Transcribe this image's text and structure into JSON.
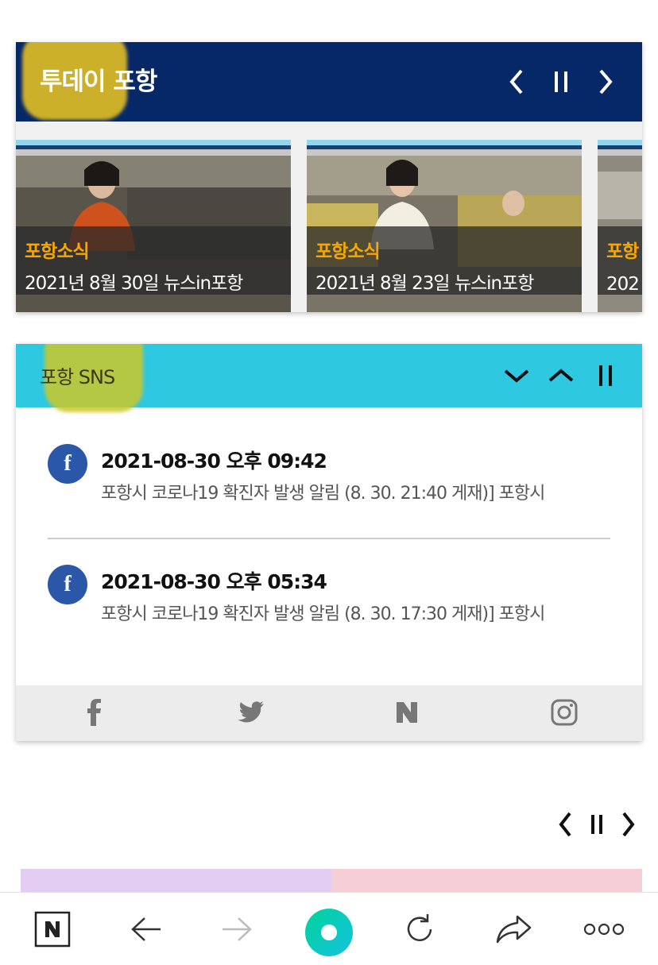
{
  "today": {
    "title": "투데이 포항",
    "prev_label": "previous",
    "pause_label": "pause",
    "next_label": "next",
    "slides": [
      {
        "category": "포항소식",
        "title": "2021년 8월 30일 뉴스in포항"
      },
      {
        "category": "포항소식",
        "title": "2021년 8월 23일 뉴스in포항"
      },
      {
        "category": "포항",
        "title": "202"
      }
    ]
  },
  "sns": {
    "title": "포항 SNS",
    "posts": [
      {
        "datetime": "2021-08-30 오후 09:42",
        "text": "포항시 코로나19 확진자 발생 알림 (8. 30. 21:40 게재)] 포항시",
        "source_icon": "facebook-icon"
      },
      {
        "datetime": "2021-08-30 오후 05:34",
        "text": "포항시 코로나19 확진자 발생 알림 (8. 30. 17:30 게재)] 포항시",
        "source_icon": "facebook-icon"
      }
    ],
    "footer_links": [
      "facebook-icon",
      "twitter-icon",
      "naver-icon",
      "instagram-icon"
    ]
  },
  "colors": {
    "header_navy": "#062867",
    "sns_cyan": "#2ec8e0",
    "category_orange": "#f7a800",
    "facebook_blue": "#2a57a8"
  },
  "toolbar": {
    "items": [
      "naver-home-icon",
      "back-arrow-icon",
      "forward-arrow-icon",
      "green-dot-icon",
      "refresh-icon",
      "share-icon",
      "more-icon"
    ]
  }
}
